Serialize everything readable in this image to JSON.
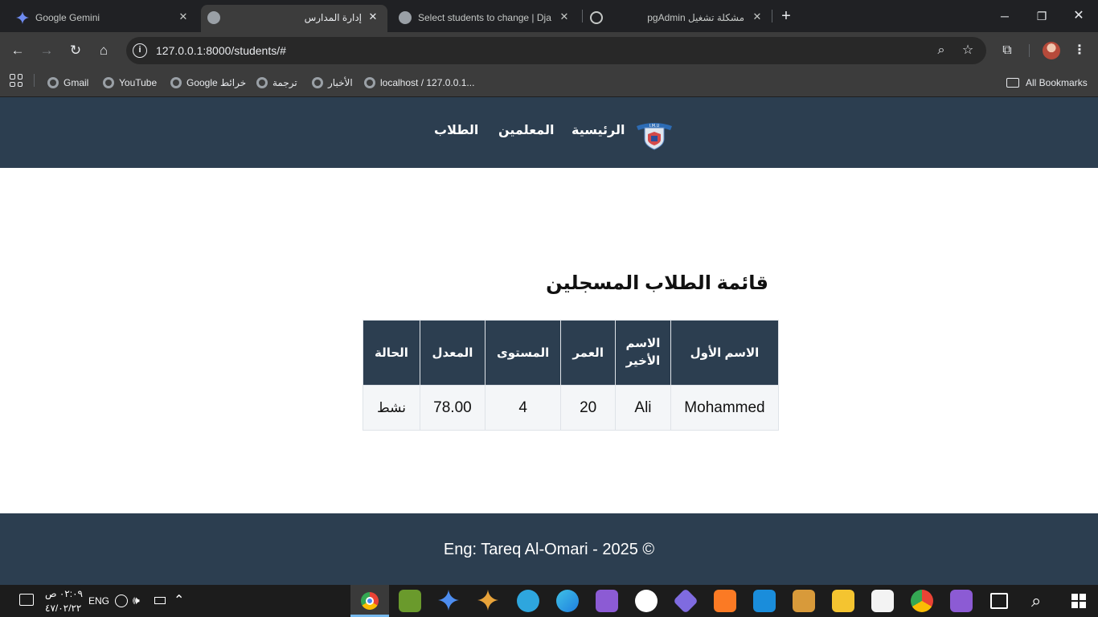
{
  "browser": {
    "tabs": [
      {
        "title": "Google Gemini"
      },
      {
        "title": "إدارة المدارس"
      },
      {
        "title": "Select students to change | Djan"
      },
      {
        "title": "pgAdmin مشكلة تشغيل"
      }
    ],
    "url": "127.0.0.1:8000/students/#",
    "bookmarks": [
      "Gmail",
      "YouTube",
      "Google خرائط",
      "ترجمة",
      "الأخبار",
      "localhost / 127.0.0.1..."
    ],
    "all_bookmarks": "All Bookmarks"
  },
  "site": {
    "nav": {
      "home": "الرئيسية",
      "teachers": "المعلمين",
      "students": "الطلاب"
    },
    "logo_text": "I.M.U",
    "page_title": "قائمة الطلاب المسجلين",
    "table": {
      "headers": [
        "الاسم الأول",
        "الاسم الأخير",
        "العمر",
        "المستوى",
        "المعدل",
        "الحالة"
      ],
      "rows": [
        [
          "Mohammed",
          "Ali",
          "20",
          "4",
          "78.00",
          "نشط"
        ]
      ]
    },
    "footer": "Eng: Tareq Al-Omari - 2025 ©"
  },
  "taskbar": {
    "time": "٠٢:٠٩ ص",
    "date": "٤٧/٠٢/٢٢",
    "lang": "ENG"
  },
  "colors": {
    "nav_bg": "#2c3e50",
    "table_header_bg": "#2c3e50",
    "footer_bg": "#2c3e50"
  }
}
